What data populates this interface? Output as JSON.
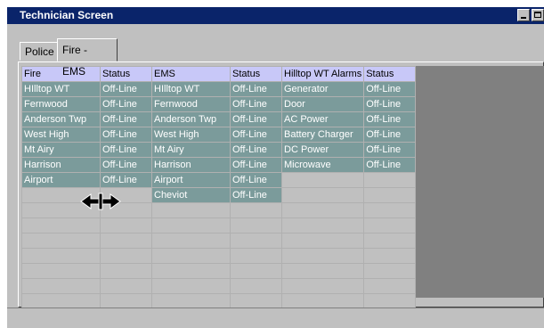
{
  "window": {
    "title": "Technician Screen"
  },
  "tabs": [
    {
      "label": "Police",
      "active": false
    },
    {
      "label": "Fire - EMS",
      "active": true
    }
  ],
  "grid": {
    "headers": [
      "Fire",
      "Status",
      "EMS",
      "Status",
      "Hilltop WT Alarms",
      "Status"
    ],
    "rows": [
      [
        "HIlltop WT",
        "Off-Line",
        "HIlltop WT",
        "Off-Line",
        "Generator",
        "Off-Line"
      ],
      [
        "Fernwood",
        "Off-Line",
        "Fernwood",
        "Off-Line",
        "Door",
        "Off-Line"
      ],
      [
        "Anderson Twp",
        "Off-Line",
        "Anderson Twp",
        "Off-Line",
        "AC Power",
        "Off-Line"
      ],
      [
        "West High",
        "Off-Line",
        "West High",
        "Off-Line",
        "Battery Charger",
        "Off-Line"
      ],
      [
        "Mt Airy",
        "Off-Line",
        "Mt Airy",
        "Off-Line",
        "DC Power",
        "Off-Line"
      ],
      [
        "Harrison",
        "Off-Line",
        "Harrison",
        "Off-Line",
        "Microwave",
        "Off-Line"
      ],
      [
        "Airport",
        "Off-Line",
        "Airport",
        "Off-Line",
        "",
        ""
      ],
      [
        "",
        "",
        "Cheviot",
        "Off-Line",
        "",
        ""
      ],
      [
        "",
        "",
        "",
        "",
        "",
        ""
      ],
      [
        "",
        "",
        "",
        "",
        "",
        ""
      ],
      [
        "",
        "",
        "",
        "",
        "",
        ""
      ],
      [
        "",
        "",
        "",
        "",
        "",
        ""
      ],
      [
        "",
        "",
        "",
        "",
        "",
        ""
      ],
      [
        "",
        "",
        "",
        "",
        "",
        ""
      ],
      [
        "",
        "",
        "",
        "",
        "",
        ""
      ],
      [
        "",
        "",
        "",
        "",
        "",
        ""
      ]
    ]
  },
  "colors": {
    "titlebar": "#0a246a",
    "header": "#c8c8f8",
    "cell": "#7b9b9b"
  },
  "icons": {
    "cursor": "resize-horizontal-cursor-icon"
  }
}
